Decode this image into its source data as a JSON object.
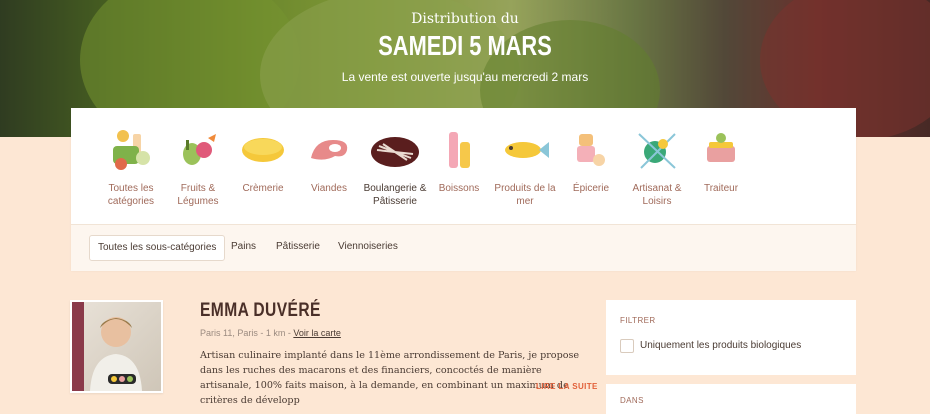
{
  "hero": {
    "subtitle": "Distribution du",
    "title": "SAMEDI 5 MARS",
    "note": "La vente est ouverte jusqu'au mercredi 2 mars"
  },
  "categories": [
    {
      "label": "Toutes les catégories",
      "icon": "all-categories-icon"
    },
    {
      "label": "Fruits & Légumes",
      "icon": "fruits-vegetables-icon"
    },
    {
      "label": "Crèmerie",
      "icon": "cheese-icon"
    },
    {
      "label": "Viandes",
      "icon": "meat-icon"
    },
    {
      "label": "Boulangerie & Pâtisserie",
      "icon": "bakery-icon"
    },
    {
      "label": "Boissons",
      "icon": "drinks-icon"
    },
    {
      "label": "Produits de la mer",
      "icon": "fish-icon"
    },
    {
      "label": "Épicerie",
      "icon": "grocery-icon"
    },
    {
      "label": "Artisanat & Loisirs",
      "icon": "crafts-icon"
    },
    {
      "label": "Traiteur",
      "icon": "catering-icon"
    }
  ],
  "subcategories": [
    "Toutes les sous-catégories",
    "Pains",
    "Pâtisserie",
    "Viennoiseries"
  ],
  "producer": {
    "name": "EMMA DUVÉRÉ",
    "location": "Paris 11, Paris - 1 km - ",
    "map_link": "Voir la carte",
    "description": "Artisan culinaire implanté dans le 11ème arrondissement de Paris, je propose dans les ruches des macarons et des financiers, concoctés de manière artisanale, 100% faits maison, à la demande, en combinant un maximum de critères de développ",
    "read_more": "LIRE LA SUITE"
  },
  "filter": {
    "title": "FILTRER",
    "option": "Uniquement les produits biologiques"
  },
  "filter2": {
    "title": "DANS"
  }
}
